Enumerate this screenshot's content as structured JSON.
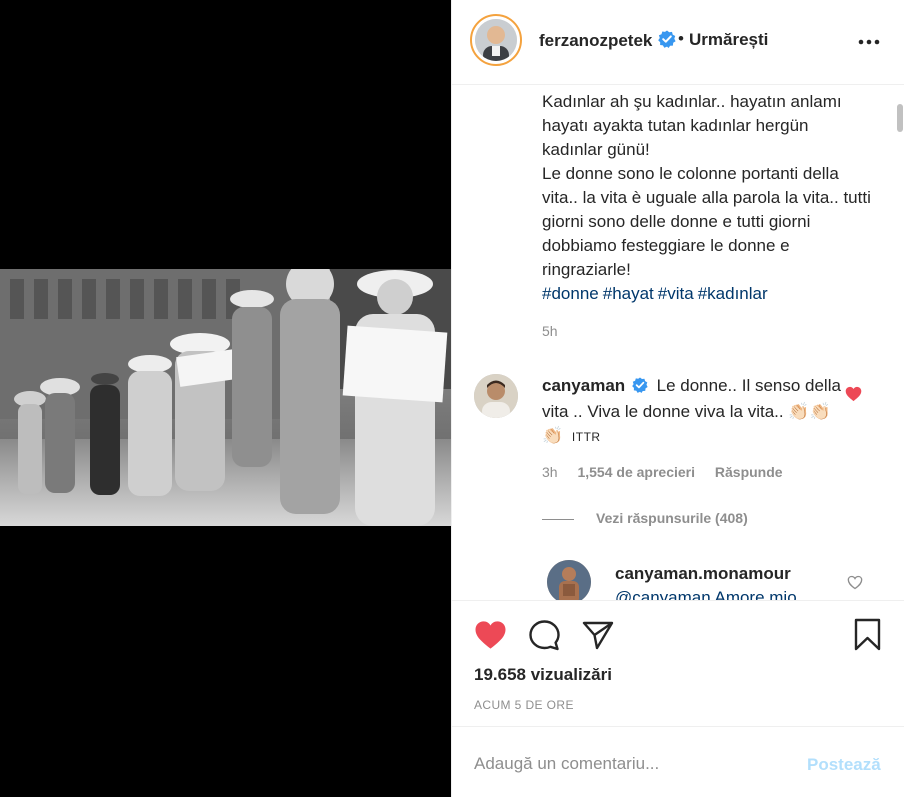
{
  "post": {
    "username": "ferzanozpetek",
    "follow_label": "Urmărești",
    "dot": "•",
    "caption": "Kadınlar ah şu kadınlar.. hayatın anlamı hayatı ayakta tutan kadınlar hergün kadınlar günü!\nLe donne sono le colonne portanti della vita.. la vita è uguale alla parola la vita.. tutti giorni sono delle donne e tutti giorni dobbiamo festeggiare le donne e ringraziarle!",
    "hashtags": [
      "#donne",
      "#hayat",
      "#vita",
      "#kadınlar"
    ],
    "caption_time": "5h"
  },
  "comment": {
    "username": "canyaman",
    "text": "Le donne.. Il senso della vita .. Viva le donne viva la vita..",
    "emojis": "👏🏻👏🏻👏🏻",
    "suffix": "ITTR",
    "time": "3h",
    "likes": "1,554 de aprecieri",
    "reply_label": "Răspunde",
    "view_replies": "Vezi răspunsurile (408)"
  },
  "reply": {
    "username": "canyaman.monamour",
    "text": "@canyaman Amore mio"
  },
  "stats": {
    "views": "19.658 vizualizări",
    "posted": "ACUM 5 DE ORE"
  },
  "add_comment": {
    "placeholder": "Adaugă un comentariu...",
    "post_label": "Postează"
  },
  "colors": {
    "like_red": "#ed4956",
    "link_blue": "#00376b",
    "verified_blue": "#3897f0",
    "post_button_disabled": "#b2dffc"
  },
  "icons": [
    "verified-badge-icon",
    "more-options-icon",
    "heart-filled-icon",
    "comment-icon",
    "share-icon",
    "bookmark-icon"
  ]
}
